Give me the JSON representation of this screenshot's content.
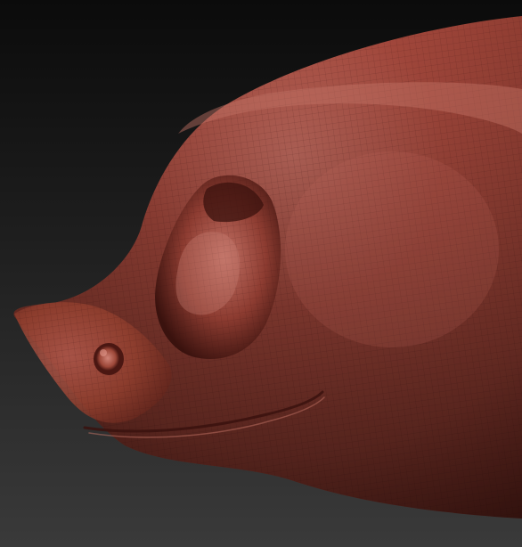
{
  "scene": {
    "subject": "sculpted-creature-head",
    "background_colors": [
      "#0b0b0b",
      "#1f1f1f",
      "#3a3a3a"
    ],
    "material_colors": {
      "highlight": "#c06a5e",
      "base": "#a4483c",
      "mid": "#8a3a2f",
      "shadow": "#5a2019",
      "deep_shadow": "#3a120e"
    },
    "wireframe_visible": true
  }
}
